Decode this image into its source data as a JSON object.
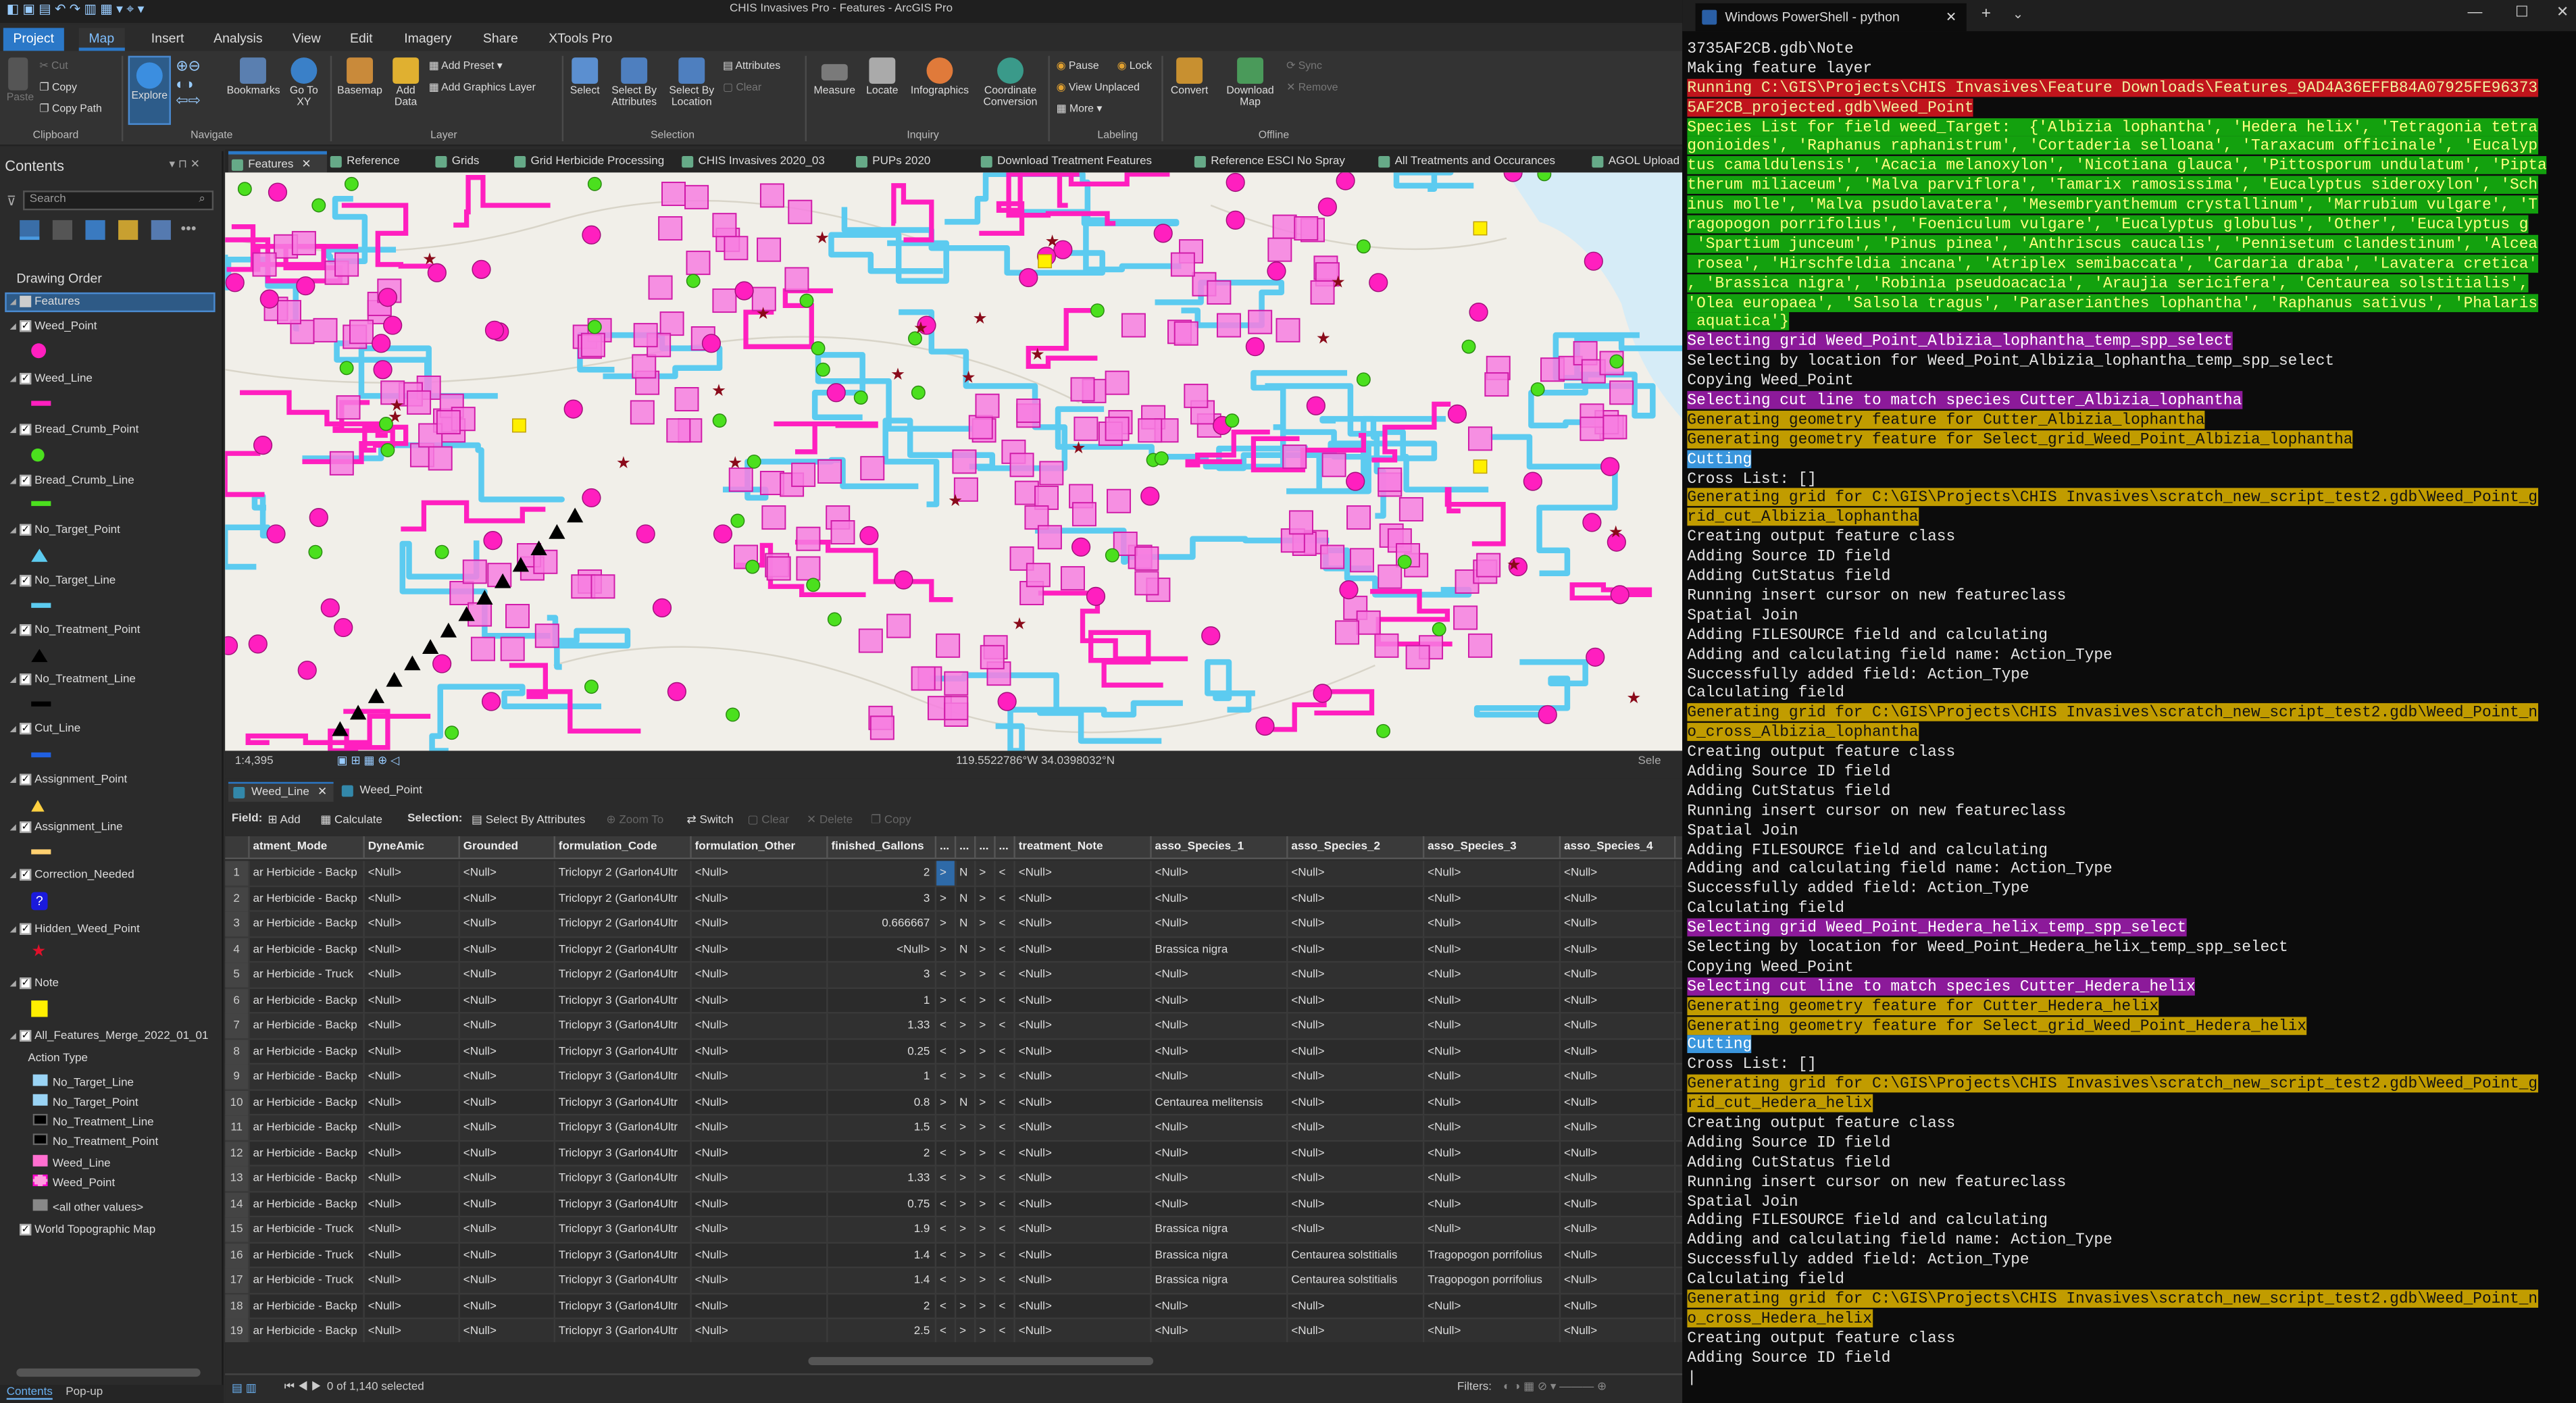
{
  "arcgis": {
    "title": "CHIS Invasives Pro - Features - ArcGIS Pro",
    "tabs": [
      "Project",
      "Map",
      "Insert",
      "Analysis",
      "View",
      "Edit",
      "Imagery",
      "Share",
      "XTools Pro"
    ],
    "ribbon": {
      "clipboard": {
        "paste": "Paste",
        "cut": "Cut",
        "copy": "Copy",
        "copy_path": "Copy Path",
        "label": "Clipboard"
      },
      "navigate": {
        "explore": "Explore",
        "bookmarks": "Bookmarks",
        "goto": "Go To XY",
        "label": "Navigate"
      },
      "layer": {
        "basemap": "Basemap",
        "add_data": "Add Data",
        "add_preset": "Add Preset",
        "add_graphics": "Add Graphics Layer",
        "label": "Layer"
      },
      "selection": {
        "select": "Select",
        "by_attr": "Select By Attributes",
        "by_loc": "Select By Location",
        "attributes": "Attributes",
        "clear": "Clear",
        "label": "Selection"
      },
      "inquiry": {
        "measure": "Measure",
        "locate": "Locate",
        "infographics": "Infographics",
        "coord": "Coordinate Conversion",
        "label": "Inquiry"
      },
      "labeling": {
        "pause": "Pause",
        "lock": "Lock",
        "view_unplaced": "View Unplaced",
        "more": "More",
        "label": "Labeling"
      },
      "offline": {
        "convert": "Convert",
        "download": "Download Map",
        "sync": "Sync",
        "remove": "Remove",
        "label": "Offline"
      }
    },
    "contents": {
      "title": "Contents",
      "search_placeholder": "Search",
      "drawing_order": "Drawing Order",
      "layers": [
        "Features",
        "Weed_Point",
        "Weed_Line",
        "Bread_Crumb_Point",
        "Bread_Crumb_Line",
        "No_Target_Point",
        "No_Target_Line",
        "No_Treatment_Point",
        "No_Treatment_Line",
        "Cut_Line",
        "Assignment_Point",
        "Assignment_Line",
        "Correction_Needed",
        "Hidden_Weed_Point",
        "Note",
        "All_Features_Merge_2022_01_01"
      ],
      "action_type": "Action Type",
      "legend": [
        "No_Target_Line",
        "No_Target_Point",
        "No_Treatment_Line",
        "No_Treatment_Point",
        "Weed_Line",
        "Weed_Point",
        "<all other values>"
      ],
      "basemap": "World Topographic Map",
      "footer_tabs": [
        "Contents",
        "Pop-up"
      ]
    },
    "map_tabs": [
      "Features",
      "Reference",
      "Grids",
      "Grid Herbicide Processing",
      "CHIS Invasives 2020_03",
      "PUPs 2020",
      "Download Treatment Features",
      "Reference ESCI No Spray",
      "All Treatments and Occurances",
      "AGOL Upload"
    ],
    "map_status": {
      "scale": "1:4,395",
      "coords": "119.5522786°W 34.0398032°N",
      "sel": "Sele"
    },
    "table": {
      "tabs": [
        "Weed_Line",
        "Weed_Point"
      ],
      "toolbar": {
        "field": "Field:",
        "add": "Add",
        "calculate": "Calculate",
        "selection": "Selection:",
        "by_attr": "Select By Attributes",
        "zoom": "Zoom To",
        "switch": "Switch",
        "clear": "Clear",
        "delete": "Delete",
        "copy": "Copy"
      },
      "columns": [
        "",
        "atment_Mode",
        "DyneAmic",
        "Grounded",
        "formulation_Code",
        "formulation_Other",
        "finished_Gallons",
        "...",
        "...",
        "...",
        "...",
        "treatment_Note",
        "asso_Species_1",
        "asso_Species_2",
        "asso_Species_3",
        "asso_Species_4"
      ],
      "rows": [
        [
          "1",
          "ar Herbicide - Backp",
          "<Null>",
          "<Null>",
          "Triclopyr 2 (Garlon4Ultr",
          "<Null>",
          "2",
          ">",
          "N",
          ">",
          "<",
          "<Null>",
          "<Null>",
          "<Null>",
          "<Null>",
          "<Null>"
        ],
        [
          "2",
          "ar Herbicide - Backp",
          "<Null>",
          "<Null>",
          "Triclopyr 2 (Garlon4Ultr",
          "<Null>",
          "3",
          ">",
          "N",
          ">",
          "<",
          "<Null>",
          "<Null>",
          "<Null>",
          "<Null>",
          "<Null>"
        ],
        [
          "3",
          "ar Herbicide - Backp",
          "<Null>",
          "<Null>",
          "Triclopyr 2 (Garlon4Ultr",
          "<Null>",
          "0.666667",
          ">",
          "N",
          ">",
          "<",
          "<Null>",
          "<Null>",
          "<Null>",
          "<Null>",
          "<Null>"
        ],
        [
          "4",
          "ar Herbicide - Backp",
          "<Null>",
          "<Null>",
          "Triclopyr 2 (Garlon4Ultr",
          "<Null>",
          "<Null>",
          ">",
          "N",
          ">",
          "<",
          "<Null>",
          "Brassica nigra",
          "<Null>",
          "<Null>",
          "<Null>"
        ],
        [
          "5",
          "ar Herbicide - Truck",
          "<Null>",
          "<Null>",
          "Triclopyr 2 (Garlon4Ultr",
          "<Null>",
          "3",
          "<",
          ">",
          ">",
          "<",
          "<Null>",
          "<Null>",
          "<Null>",
          "<Null>",
          "<Null>"
        ],
        [
          "6",
          "ar Herbicide - Backp",
          "<Null>",
          "<Null>",
          "Triclopyr 3 (Garlon4Ultr",
          "<Null>",
          "1",
          ">",
          "<",
          ">",
          "<",
          "<Null>",
          "<Null>",
          "<Null>",
          "<Null>",
          "<Null>"
        ],
        [
          "7",
          "ar Herbicide - Backp",
          "<Null>",
          "<Null>",
          "Triclopyr 3 (Garlon4Ultr",
          "<Null>",
          "1.33",
          "<",
          ">",
          ">",
          "<",
          "<Null>",
          "<Null>",
          "<Null>",
          "<Null>",
          "<Null>"
        ],
        [
          "8",
          "ar Herbicide - Backp",
          "<Null>",
          "<Null>",
          "Triclopyr 3 (Garlon4Ultr",
          "<Null>",
          "0.25",
          "<",
          ">",
          ">",
          "<",
          "<Null>",
          "<Null>",
          "<Null>",
          "<Null>",
          "<Null>"
        ],
        [
          "9",
          "ar Herbicide - Backp",
          "<Null>",
          "<Null>",
          "Triclopyr 3 (Garlon4Ultr",
          "<Null>",
          "1",
          "<",
          ">",
          ">",
          "<",
          "<Null>",
          "<Null>",
          "<Null>",
          "<Null>",
          "<Null>"
        ],
        [
          "10",
          "ar Herbicide - Backp",
          "<Null>",
          "<Null>",
          "Triclopyr 3 (Garlon4Ultr",
          "<Null>",
          "0.8",
          ">",
          "N",
          ">",
          "<",
          "<Null>",
          "Centaurea melitensis",
          "<Null>",
          "<Null>",
          "<Null>"
        ],
        [
          "11",
          "ar Herbicide - Backp",
          "<Null>",
          "<Null>",
          "Triclopyr 3 (Garlon4Ultr",
          "<Null>",
          "1.5",
          "<",
          ">",
          ">",
          "<",
          "<Null>",
          "<Null>",
          "<Null>",
          "<Null>",
          "<Null>"
        ],
        [
          "12",
          "ar Herbicide - Backp",
          "<Null>",
          "<Null>",
          "Triclopyr 3 (Garlon4Ultr",
          "<Null>",
          "2",
          "<",
          ">",
          ">",
          "<",
          "<Null>",
          "<Null>",
          "<Null>",
          "<Null>",
          "<Null>"
        ],
        [
          "13",
          "ar Herbicide - Backp",
          "<Null>",
          "<Null>",
          "Triclopyr 3 (Garlon4Ultr",
          "<Null>",
          "1.33",
          "<",
          ">",
          ">",
          "<",
          "<Null>",
          "<Null>",
          "<Null>",
          "<Null>",
          "<Null>"
        ],
        [
          "14",
          "ar Herbicide - Backp",
          "<Null>",
          "<Null>",
          "Triclopyr 3 (Garlon4Ultr",
          "<Null>",
          "0.75",
          "<",
          ">",
          ">",
          "<",
          "<Null>",
          "<Null>",
          "<Null>",
          "<Null>",
          "<Null>"
        ],
        [
          "15",
          "ar Herbicide - Truck",
          "<Null>",
          "<Null>",
          "Triclopyr 3 (Garlon4Ultr",
          "<Null>",
          "1.9",
          "<",
          ">",
          ">",
          "<",
          "<Null>",
          "Brassica nigra",
          "<Null>",
          "<Null>",
          "<Null>"
        ],
        [
          "16",
          "ar Herbicide - Truck",
          "<Null>",
          "<Null>",
          "Triclopyr 3 (Garlon4Ultr",
          "<Null>",
          "1.4",
          "<",
          ">",
          ">",
          "<",
          "<Null>",
          "Brassica nigra",
          "Centaurea solstitialis",
          "Tragopogon porrifolius",
          "<Null>"
        ],
        [
          "17",
          "ar Herbicide - Truck",
          "<Null>",
          "<Null>",
          "Triclopyr 3 (Garlon4Ultr",
          "<Null>",
          "1.4",
          "<",
          ">",
          ">",
          "<",
          "<Null>",
          "Brassica nigra",
          "Centaurea solstitialis",
          "Tragopogon porrifolius",
          "<Null>"
        ],
        [
          "18",
          "ar Herbicide - Backp",
          "<Null>",
          "<Null>",
          "Triclopyr 3 (Garlon4Ultr",
          "<Null>",
          "2",
          "<",
          ">",
          ">",
          "<",
          "<Null>",
          "<Null>",
          "<Null>",
          "<Null>",
          "<Null>"
        ],
        [
          "19",
          "ar Herbicide - Backp",
          "<Null>",
          "<Null>",
          "Triclopyr 3 (Garlon4Ultr",
          "<Null>",
          "2.5",
          "<",
          ">",
          ">",
          "<",
          "<Null>",
          "<Null>",
          "<Null>",
          "<Null>",
          "<Null>"
        ]
      ],
      "footer": {
        "selected": "0 of 1,140 selected",
        "filters": "Filters:"
      }
    },
    "colors": {
      "weed": "#ff1fbf",
      "line": "#5ccbf0",
      "green": "#4be01e",
      "ribbon": "#333333",
      "accent": "#2b78c8"
    }
  },
  "powershell": {
    "tab_title": "Windows PowerShell - python",
    "lines": [
      {
        "t": "3735AF2CB.gdb\\Note",
        "c": ""
      },
      {
        "t": "Making feature layer",
        "c": ""
      },
      {
        "t": "Running C:\\GIS\\Projects\\CHIS Invasives\\Feature Downloads\\Features_9AD4A36EFFB84A07925FE96373",
        "c": "bg-red"
      },
      {
        "t": "5AF2CB_projected.gdb\\Weed_Point",
        "c": "bg-red"
      },
      {
        "t": "Species List for field weed_Target:  {'Albizia lophantha', 'Hedera helix', 'Tetragonia tetra",
        "c": "bg-green"
      },
      {
        "t": "gonioides', 'Raphanus raphanistrum', 'Cortaderia selloana', 'Taraxacum officinale', 'Eucalyp",
        "c": "bg-green"
      },
      {
        "t": "tus camaldulensis', 'Acacia melanoxylon', 'Nicotiana glauca', 'Pittosporum undulatum', 'Pipta",
        "c": "bg-green"
      },
      {
        "t": "therum miliaceum', 'Malva parviflora', 'Tamarix ramosissima', 'Eucalyptus sideroxylon', 'Sch",
        "c": "bg-green"
      },
      {
        "t": "inus molle', 'Malva psudolavatera', 'Mesembryanthemum crystallinum', 'Marrubium vulgare', 'T",
        "c": "bg-green"
      },
      {
        "t": "ragopogon porrifolius', 'Foeniculum vulgare', 'Eucalyptus globulus', 'Other', 'Eucalyptus g",
        "c": "bg-green"
      },
      {
        "t": " 'Spartium junceum', 'Pinus pinea', 'Anthriscus caucalis', 'Pennisetum clandestinum', 'Alcea",
        "c": "bg-green"
      },
      {
        "t": " rosea', 'Hirschfeldia incana', 'Atriplex semibaccata', 'Cardaria draba', 'Lavatera cretica'",
        "c": "bg-green"
      },
      {
        "t": ", 'Brassica nigra', 'Robinia pseudoacacia', 'Araujia sericifera', 'Centaurea solstitialis',",
        "c": "bg-green"
      },
      {
        "t": "'Olea europaea', 'Salsola tragus', 'Paraserianthes lophantha', 'Raphanus sativus', 'Phalaris",
        "c": "bg-green"
      },
      {
        "t": " aquatica'}",
        "c": "bg-green"
      },
      {
        "t": "Selecting grid Weed_Point_Albizia_lophantha_temp_spp_select",
        "c": "bg-mag"
      },
      {
        "t": "Selecting by location for Weed_Point_Albizia_lophantha_temp_spp_select",
        "c": ""
      },
      {
        "t": "Copying Weed_Point",
        "c": ""
      },
      {
        "t": "Selecting cut line to match species Cutter_Albizia_lophantha",
        "c": "bg-mag"
      },
      {
        "t": "Generating geometry feature for Cutter_Albizia_lophantha",
        "c": "bg-yel"
      },
      {
        "t": "Generating geometry feature for Select_grid_Weed_Point_Albizia_lophantha",
        "c": "bg-yel"
      },
      {
        "t": "Cutting",
        "c": "bg-cyan"
      },
      {
        "t": "Cross List: []",
        "c": ""
      },
      {
        "t": "Generating grid for C:\\GIS\\Projects\\CHIS Invasives\\scratch_new_script_test2.gdb\\Weed_Point_g",
        "c": "bg-yel"
      },
      {
        "t": "rid_cut_Albizia_lophantha",
        "c": "bg-yel"
      },
      {
        "t": "Creating output feature class",
        "c": ""
      },
      {
        "t": "Adding Source ID field",
        "c": ""
      },
      {
        "t": "Adding CutStatus field",
        "c": ""
      },
      {
        "t": "Running insert cursor on new featureclass",
        "c": ""
      },
      {
        "t": "Spatial Join",
        "c": ""
      },
      {
        "t": "Adding FILESOURCE field and calculating",
        "c": ""
      },
      {
        "t": "Adding and calculating field name: Action_Type",
        "c": ""
      },
      {
        "t": "Successfully added field: Action_Type",
        "c": ""
      },
      {
        "t": "Calculating field",
        "c": ""
      },
      {
        "t": "Generating grid for C:\\GIS\\Projects\\CHIS Invasives\\scratch_new_script_test2.gdb\\Weed_Point_n",
        "c": "bg-yel"
      },
      {
        "t": "o_cross_Albizia_lophantha",
        "c": "bg-yel"
      },
      {
        "t": "Creating output feature class",
        "c": ""
      },
      {
        "t": "Adding Source ID field",
        "c": ""
      },
      {
        "t": "Adding CutStatus field",
        "c": ""
      },
      {
        "t": "Running insert cursor on new featureclass",
        "c": ""
      },
      {
        "t": "Spatial Join",
        "c": ""
      },
      {
        "t": "Adding FILESOURCE field and calculating",
        "c": ""
      },
      {
        "t": "Adding and calculating field name: Action_Type",
        "c": ""
      },
      {
        "t": "Successfully added field: Action_Type",
        "c": ""
      },
      {
        "t": "Calculating field",
        "c": ""
      },
      {
        "t": "Selecting grid Weed_Point_Hedera_helix_temp_spp_select",
        "c": "bg-mag"
      },
      {
        "t": "Selecting by location for Weed_Point_Hedera_helix_temp_spp_select",
        "c": ""
      },
      {
        "t": "Copying Weed_Point",
        "c": ""
      },
      {
        "t": "Selecting cut line to match species Cutter_Hedera_helix",
        "c": "bg-mag"
      },
      {
        "t": "Generating geometry feature for Cutter_Hedera_helix",
        "c": "bg-yel"
      },
      {
        "t": "Generating geometry feature for Select_grid_Weed_Point_Hedera_helix",
        "c": "bg-yel"
      },
      {
        "t": "Cutting",
        "c": "bg-cyan"
      },
      {
        "t": "Cross List: []",
        "c": ""
      },
      {
        "t": "Generating grid for C:\\GIS\\Projects\\CHIS Invasives\\scratch_new_script_test2.gdb\\Weed_Point_g",
        "c": "bg-yel"
      },
      {
        "t": "rid_cut_Hedera_helix",
        "c": "bg-yel"
      },
      {
        "t": "Creating output feature class",
        "c": ""
      },
      {
        "t": "Adding Source ID field",
        "c": ""
      },
      {
        "t": "Adding CutStatus field",
        "c": ""
      },
      {
        "t": "Running insert cursor on new featureclass",
        "c": ""
      },
      {
        "t": "Spatial Join",
        "c": ""
      },
      {
        "t": "Adding FILESOURCE field and calculating",
        "c": ""
      },
      {
        "t": "Adding and calculating field name: Action_Type",
        "c": ""
      },
      {
        "t": "Successfully added field: Action_Type",
        "c": ""
      },
      {
        "t": "Calculating field",
        "c": ""
      },
      {
        "t": "Generating grid for C:\\GIS\\Projects\\CHIS Invasives\\scratch_new_script_test2.gdb\\Weed_Point_n",
        "c": "bg-yel"
      },
      {
        "t": "o_cross_Hedera_helix",
        "c": "bg-yel"
      },
      {
        "t": "Creating output feature class",
        "c": ""
      },
      {
        "t": "Adding Source ID field",
        "c": ""
      },
      {
        "t": "|",
        "c": ""
      }
    ]
  }
}
